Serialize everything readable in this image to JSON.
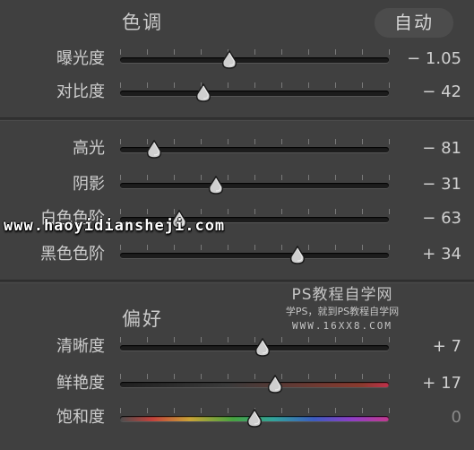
{
  "tone": {
    "title": "色调",
    "auto_label": "自动",
    "rows": [
      {
        "label": "曝光度",
        "value": "− 1.05",
        "position": 0.405,
        "track": "dark"
      },
      {
        "label": "对比度",
        "value": "− 42",
        "position": 0.31,
        "track": "dark"
      }
    ]
  },
  "light": {
    "rows": [
      {
        "label": "高光",
        "value": "− 81",
        "position": 0.125,
        "track": "dark"
      },
      {
        "label": "阴影",
        "value": "− 31",
        "position": 0.355,
        "track": "dark"
      },
      {
        "label": "白色色阶",
        "value": "− 63",
        "position": 0.22,
        "track": "dark"
      },
      {
        "label": "黑色色阶",
        "value": "+ 34",
        "position": 0.66,
        "track": "dark"
      }
    ]
  },
  "pref": {
    "title": "偏好",
    "rows": [
      {
        "label": "清晰度",
        "value": "+ 7",
        "position": 0.53,
        "track": "dark"
      },
      {
        "label": "鲜艳度",
        "value": "+ 17",
        "position": 0.575,
        "track": "vib"
      },
      {
        "label": "饱和度",
        "value": "0",
        "position": 0.5,
        "track": "sat"
      }
    ]
  },
  "watermarks": {
    "site": "www.haoyidiansheji.com",
    "title": "PS教程自学网",
    "subtitle": "学PS，就到PS教程自学网",
    "url": "WWW.16XX8.COM"
  }
}
